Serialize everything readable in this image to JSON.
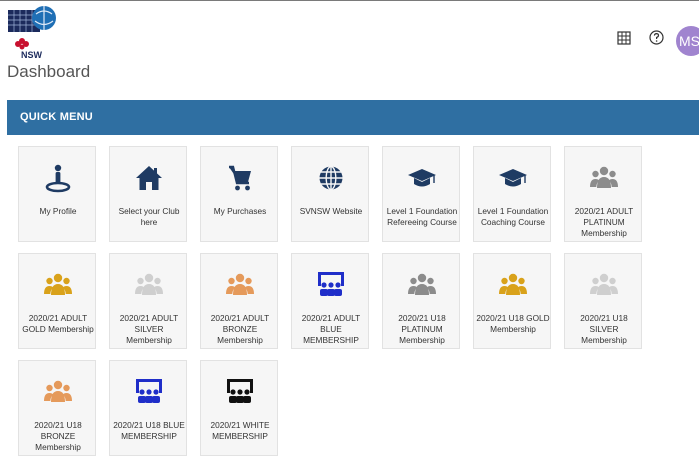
{
  "header": {
    "logo_text": "NSW",
    "avatar_initials": "MS"
  },
  "page": {
    "title": "Dashboard"
  },
  "quick_menu": {
    "title": "QUICK MENU",
    "tiles": [
      {
        "label": "My Profile",
        "icon": "person-pin-icon",
        "color": "#1f3b63"
      },
      {
        "label": "Select your Club here",
        "icon": "home-icon",
        "color": "#1f3b63"
      },
      {
        "label": "My Purchases",
        "icon": "cart-icon",
        "color": "#1f3b63"
      },
      {
        "label": "SVNSW Website",
        "icon": "globe-icon",
        "color": "#1f3b63"
      },
      {
        "label": "Level 1 Foundation Refereeing Course",
        "icon": "graduation-cap-icon",
        "color": "#1f3b63"
      },
      {
        "label": "Level 1 Foundation Coaching Course",
        "icon": "graduation-cap-icon",
        "color": "#1f3b63"
      },
      {
        "label": "2020/21 ADULT PLATINUM Membership",
        "icon": "group-icon",
        "color": "#8c8c8c"
      },
      {
        "label": "2020/21 ADULT GOLD Membership",
        "icon": "group-icon",
        "color": "#d9a21b"
      },
      {
        "label": "2020/21 ADULT SILVER Membership",
        "icon": "group-icon",
        "color": "#cfcfcf"
      },
      {
        "label": "2020/21 ADULT BRONZE Membership",
        "icon": "group-icon",
        "color": "#e59a5b"
      },
      {
        "label": "2020/21 ADULT BLUE MEMBERSHIP",
        "icon": "presentation-group-icon",
        "color": "#1f2ec9"
      },
      {
        "label": "2020/21 U18 PLATINUM Membership",
        "icon": "group-icon",
        "color": "#8c8c8c"
      },
      {
        "label": "2020/21 U18 GOLD Membership",
        "icon": "group-icon",
        "color": "#d9a21b"
      },
      {
        "label": "2020/21 U18 SILVER Membership",
        "icon": "group-icon",
        "color": "#cfcfcf"
      },
      {
        "label": "2020/21 U18 BRONZE Membership",
        "icon": "group-icon",
        "color": "#e59a5b"
      },
      {
        "label": "2020/21 U18 BLUE MEMBERSHIP",
        "icon": "presentation-group-icon",
        "color": "#1f2ec9"
      },
      {
        "label": "2020/21 WHITE MEMBERSHIP",
        "icon": "presentation-group-icon",
        "color": "#111111"
      }
    ]
  }
}
